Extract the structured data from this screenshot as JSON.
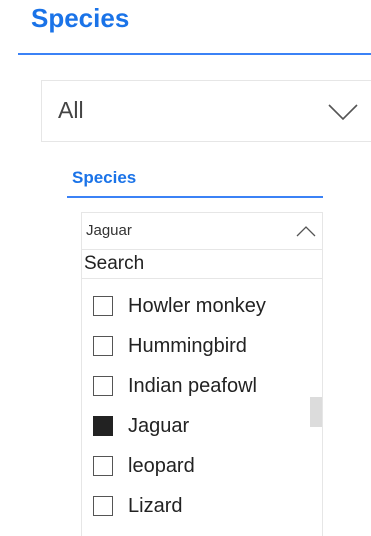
{
  "header": {
    "title": "Species"
  },
  "main_select": {
    "value": "All",
    "icon": "chevron-down-icon"
  },
  "species_filter": {
    "title": "Species",
    "selected_value": "Jaguar",
    "icon": "chevron-up-icon",
    "search_placeholder": "Search",
    "items": [
      {
        "label": "Howler monkey",
        "checked": false
      },
      {
        "label": "Hummingbird",
        "checked": false
      },
      {
        "label": "Indian peafowl",
        "checked": false
      },
      {
        "label": "Jaguar",
        "checked": true
      },
      {
        "label": "leopard",
        "checked": false
      },
      {
        "label": "Lizard",
        "checked": false
      }
    ]
  },
  "colors": {
    "accent": "#1a73e8",
    "underline": "#3b82f6",
    "border": "#e6e6e6",
    "text": "#222222",
    "checked_fill": "#222222",
    "scroll_thumb": "#dcdcdc"
  }
}
